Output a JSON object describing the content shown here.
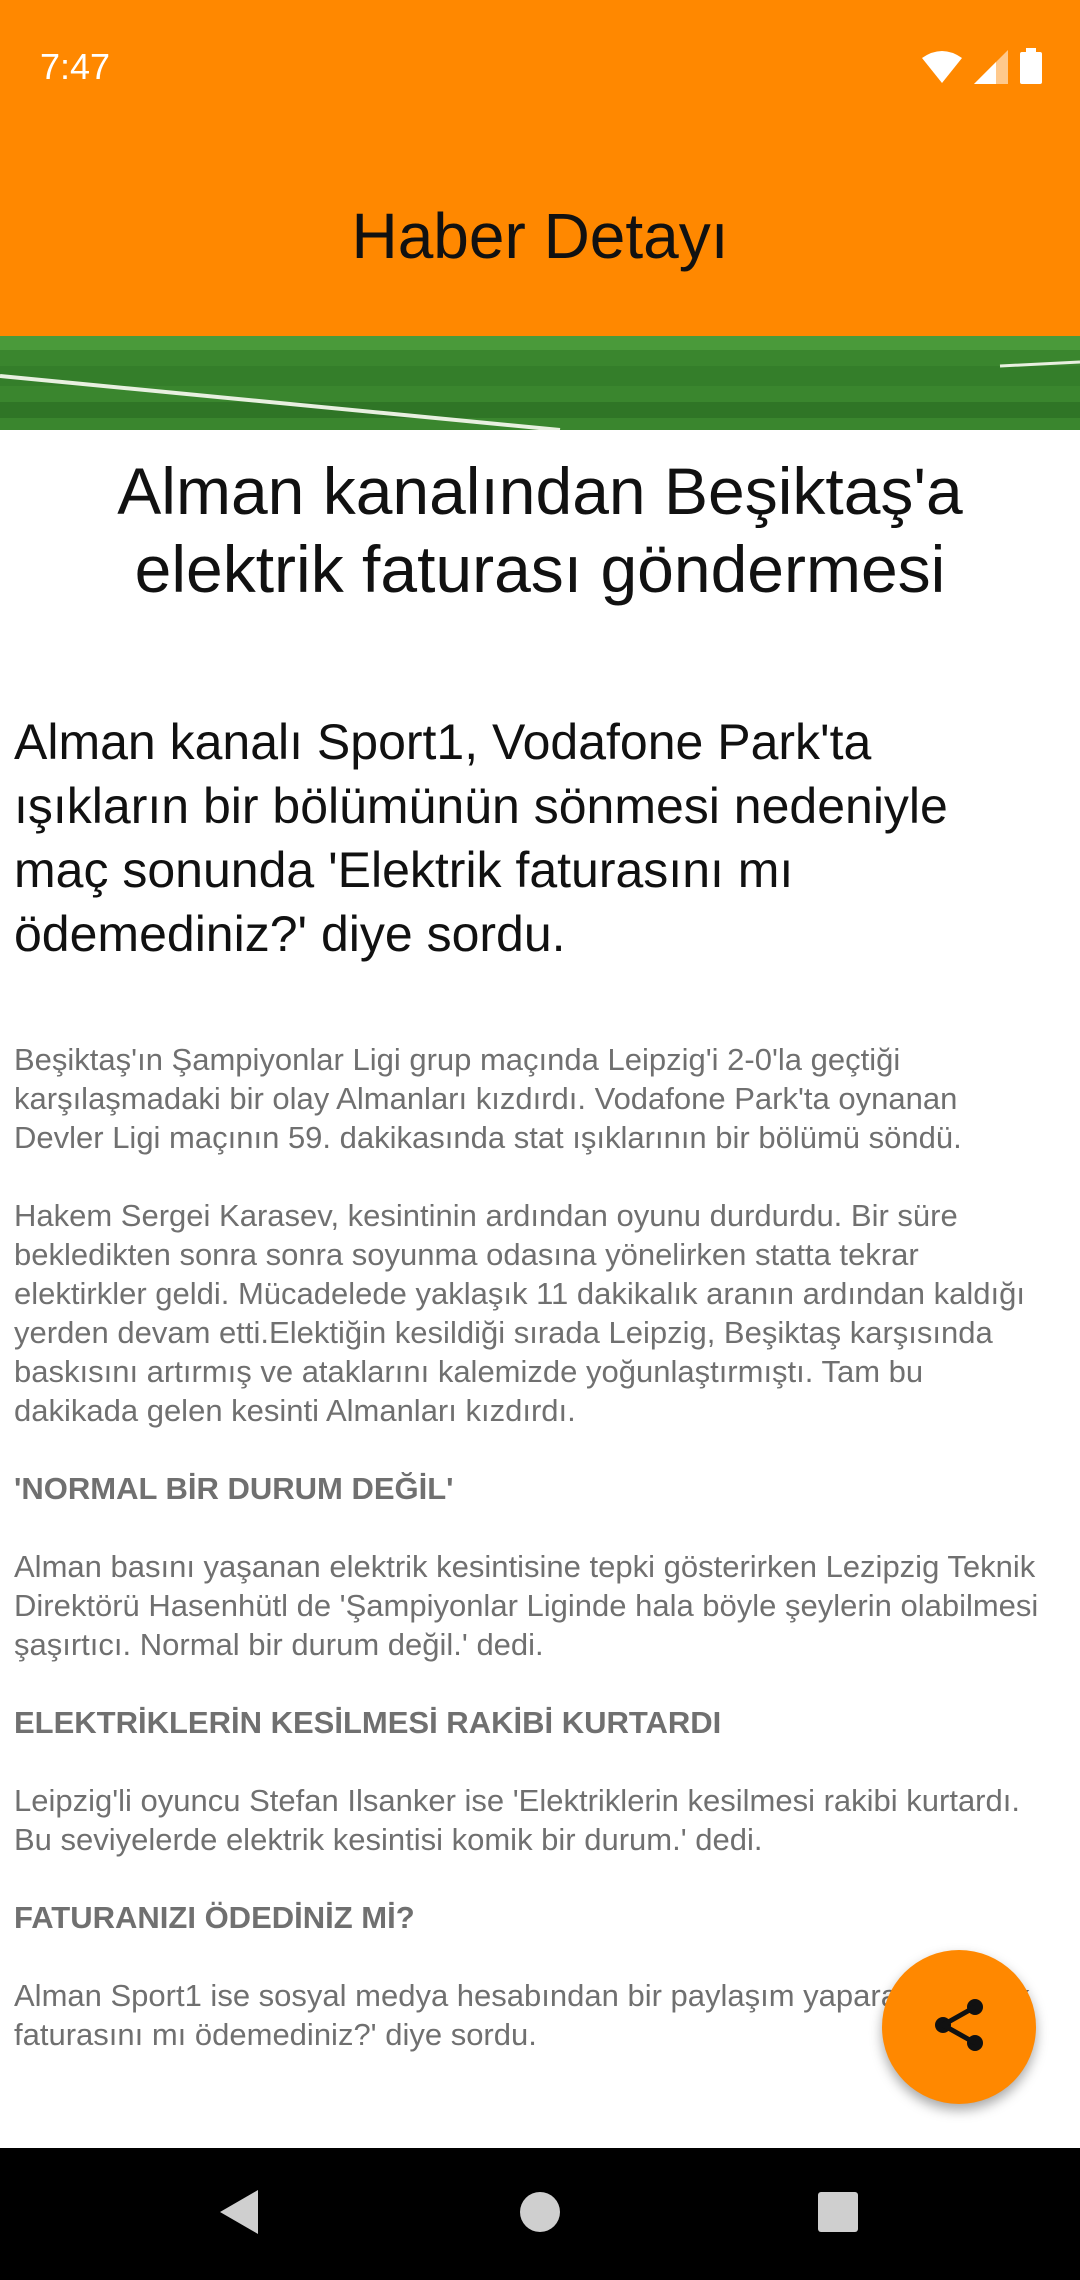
{
  "status_bar": {
    "time": "7:47",
    "icons": [
      "wifi-icon",
      "signal-icon",
      "battery-icon"
    ]
  },
  "app_bar": {
    "title": "Haber Detayı"
  },
  "article": {
    "headline": "Alman kanalından Beşiktaş'a elektrik faturası göndermesi",
    "summary": "Alman kanalı Sport1, Vodafone Park'ta ışıkların bir bölümünün sönmesi nedeniyle maç sonunda 'Elektrik faturasını mı ödemediniz?' diye sordu.",
    "paragraph_1": "Beşiktaş'ın Şampiyonlar Ligi grup maçında Leipzig'i 2-0'la geçtiği karşılaşmadaki bir olay Almanları kızdırdı. Vodafone Park'ta oynanan Devler Ligi maçının 59. dakikasında stat ışıklarının bir bölümü söndü.",
    "paragraph_2": "Hakem Sergei Karasev, kesintinin ardından oyunu durdurdu. Bir süre bekledikten sonra sonra soyunma odasına yönelirken statta tekrar elektirkler geldi. Mücadelede yaklaşık 11 dakikalık aranın ardından kaldığı yerden devam etti.Elektiğin kesildiği sırada Leipzig, Beşiktaş karşısında baskısını artırmış ve ataklarını kalemizde yoğunlaştırmıştı. Tam bu dakikada gelen kesinti Almanları kızdırdı.",
    "heading_1": "'NORMAL BİR DURUM DEĞİL'",
    "paragraph_3": "Alman basını yaşanan elektrik kesintisine tepki gösterirken Lezipzig Teknik Direktörü Hasenhütl de 'Şampiyonlar Liginde hala böyle şeylerin olabilmesi şaşırtıcı. Normal bir durum değil.' dedi.",
    "heading_2": "ELEKTRİKLERİN KESİLMESİ RAKİBİ KURTARDI",
    "paragraph_4": "Leipzig'li oyuncu Stefan Ilsanker ise 'Elektriklerin kesilmesi rakibi kurtardı. Bu seviyelerde elektrik kesintisi komik bir durum.' dedi.",
    "heading_3": "FATURANIZI ÖDEDİNİZ Mİ?",
    "paragraph_5": "Alman Sport1 ise sosyal medya hesabından bir paylaşım yaparak 'Elektrik faturasını mı ödemediniz?' diye sordu."
  },
  "fab": {
    "icon": "share-icon"
  },
  "nav_bar": {
    "icons": [
      "back-icon",
      "home-icon",
      "recents-icon"
    ]
  },
  "colors": {
    "accent": "#FF8800",
    "body_text": "#707070"
  }
}
